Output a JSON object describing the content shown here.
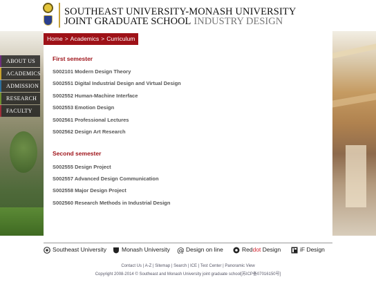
{
  "header": {
    "title_line1": "SOUTHEAST UNIVERSITY-MONASH UNIVERSITY",
    "title_line2": "JOINT GRADUATE SCHOOL",
    "title_line2_sub": "INDUSTRY DESIGN"
  },
  "breadcrumb": {
    "home": "Home",
    "academics": "Academics",
    "curriculum": "Curriculum",
    "separator": ">"
  },
  "nav": {
    "items": [
      {
        "label": "ABOUT US"
      },
      {
        "label": "ACADEMICS"
      },
      {
        "label": "ADMISSION"
      },
      {
        "label": "RESEARCH"
      },
      {
        "label": "FACULTY"
      }
    ]
  },
  "first_semester": {
    "title": "First semester",
    "courses": [
      "S002101 Modern Design Theory",
      "S002551 Digital Industrial Design and Virtual Design",
      "S002552 Human-Machine Interface",
      "S002553 Emotion Design",
      "S002561 Professional Lectures",
      "S002562 Design Art Research"
    ]
  },
  "second_semester": {
    "title": "Second semester",
    "courses": [
      "S002555 Design Project",
      "S002557 Advanced Design Communication",
      "S002558 Major Design Project",
      "S002560 Research Methods in Industrial Design"
    ]
  },
  "footer": {
    "partners": {
      "southeast": "Southeast University",
      "monash": "Monash University",
      "design_online": "Design on line",
      "reddot_pre": "Red",
      "reddot_red": "dot",
      "reddot_post": " Design",
      "ifdesign": "iF Design"
    },
    "links": {
      "contact": "Contact Us",
      "az": "A-Z",
      "sitemap": "Sitemap",
      "search": "Search",
      "ice": "ICE",
      "testcenter": "Test Center",
      "panoramic": "Panoramic View",
      "sep": " | "
    },
    "copyright": "Copyright 2008-2014 © Southeast and Monash University joint graduate school[苏ICP备07016150号]"
  }
}
